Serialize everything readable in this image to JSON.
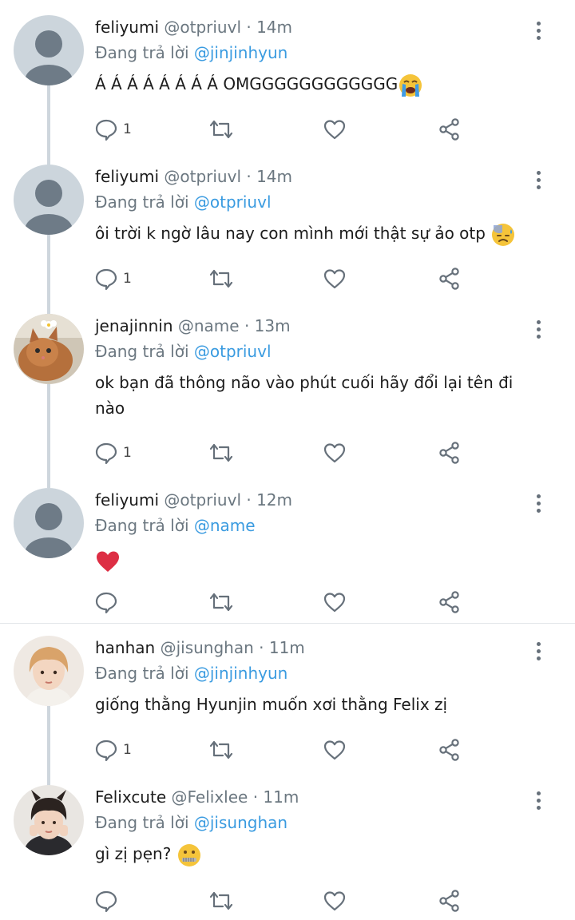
{
  "reply_prefix": "Đang trả lời",
  "tweets": [
    {
      "name": "feliyumi",
      "handle": "@otpriuvl",
      "time": "14m",
      "reply_to": "@jinjinhyun",
      "text": "Á Á Á Á Á Á Á Á OMGGGGGGGGGGGG",
      "emoji": "crying-face",
      "comments": "1"
    },
    {
      "name": "feliyumi",
      "handle": "@otpriuvl",
      "time": "14m",
      "reply_to": "@otpriuvl",
      "text": "ôi trời k ngờ lâu nay con mình mới thật sự ảo otp",
      "emoji": "sad-sweat-face",
      "comments": "1"
    },
    {
      "name": "jenajinnin",
      "handle": "@name",
      "time": "13m",
      "reply_to": "@otpriuvl",
      "text_line1": "ok bạn đã thông não vào phút cuối hãy đổi lại tên đi",
      "text_line2": "nào",
      "comments": "1"
    },
    {
      "name": "feliyumi",
      "handle": "@otpriuvl",
      "time": "12m",
      "reply_to": "@name",
      "emoji": "red-heart",
      "comments": ""
    },
    {
      "name": "hanhan",
      "handle": "@jisunghan",
      "time": "11m",
      "reply_to": "@jinjinhyun",
      "text": "giống thằng Hyunjin muốn xơi thằng Felix zị",
      "comments": "1"
    },
    {
      "name": "Felixcute",
      "handle": "@Felixlee",
      "time": "11m",
      "reply_to": "@jisunghan",
      "text": "gì zị pẹn?",
      "emoji": "zipper-mouth-face",
      "comments": ""
    }
  ],
  "colors": {
    "link": "#3a9be0",
    "muted": "#6b7780",
    "icon": "#66707a"
  }
}
